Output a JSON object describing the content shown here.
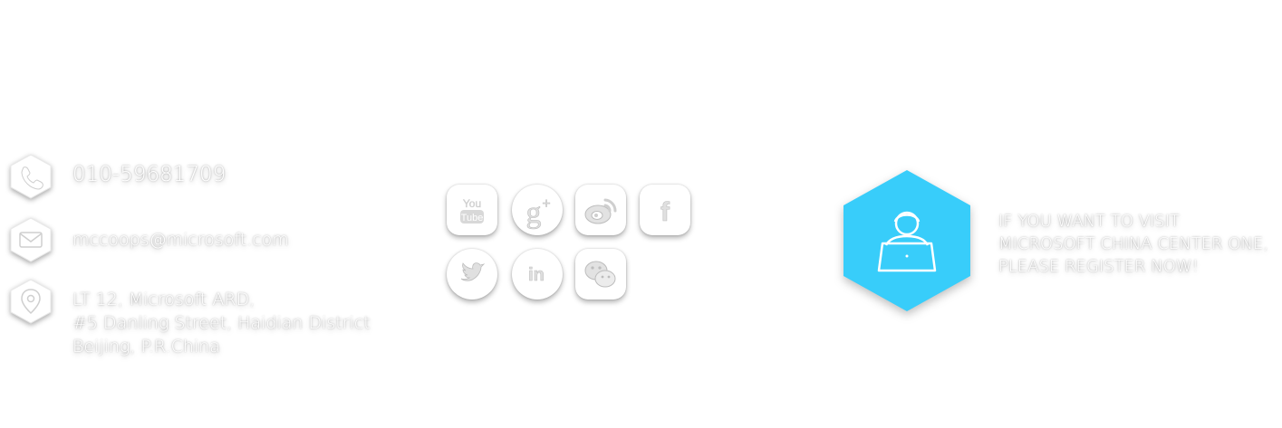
{
  "contact": {
    "phone": "010-59681709",
    "email": "mccoops@microsoft.com",
    "address_lines": [
      "LT 12, Microsoft ARD,",
      "#5 Danling Street, Haidian District",
      "Beijing, P.R.China"
    ]
  },
  "social": [
    {
      "name": "youtube",
      "icon": "youtube-icon",
      "text": "You\nTube"
    },
    {
      "name": "google-plus",
      "icon": "google-plus-icon",
      "text": "g+"
    },
    {
      "name": "weibo",
      "icon": "weibo-icon",
      "text": ""
    },
    {
      "name": "facebook",
      "icon": "facebook-icon",
      "text": "f"
    },
    {
      "name": "twitter",
      "icon": "twitter-icon",
      "text": ""
    },
    {
      "name": "linkedin",
      "icon": "linkedin-icon",
      "text": "in"
    },
    {
      "name": "wechat",
      "icon": "wechat-icon",
      "text": ""
    }
  ],
  "register": {
    "icon": "user-laptop-icon",
    "lines": [
      "IF YOU WANT TO VISIT",
      "MICROSOFT CHINA CENTER ONE,",
      "PLEASE REGISTER NOW!"
    ]
  },
  "colors": {
    "accent": "#38cdfa",
    "text": "#ffffff",
    "badge": "#ffffff"
  }
}
